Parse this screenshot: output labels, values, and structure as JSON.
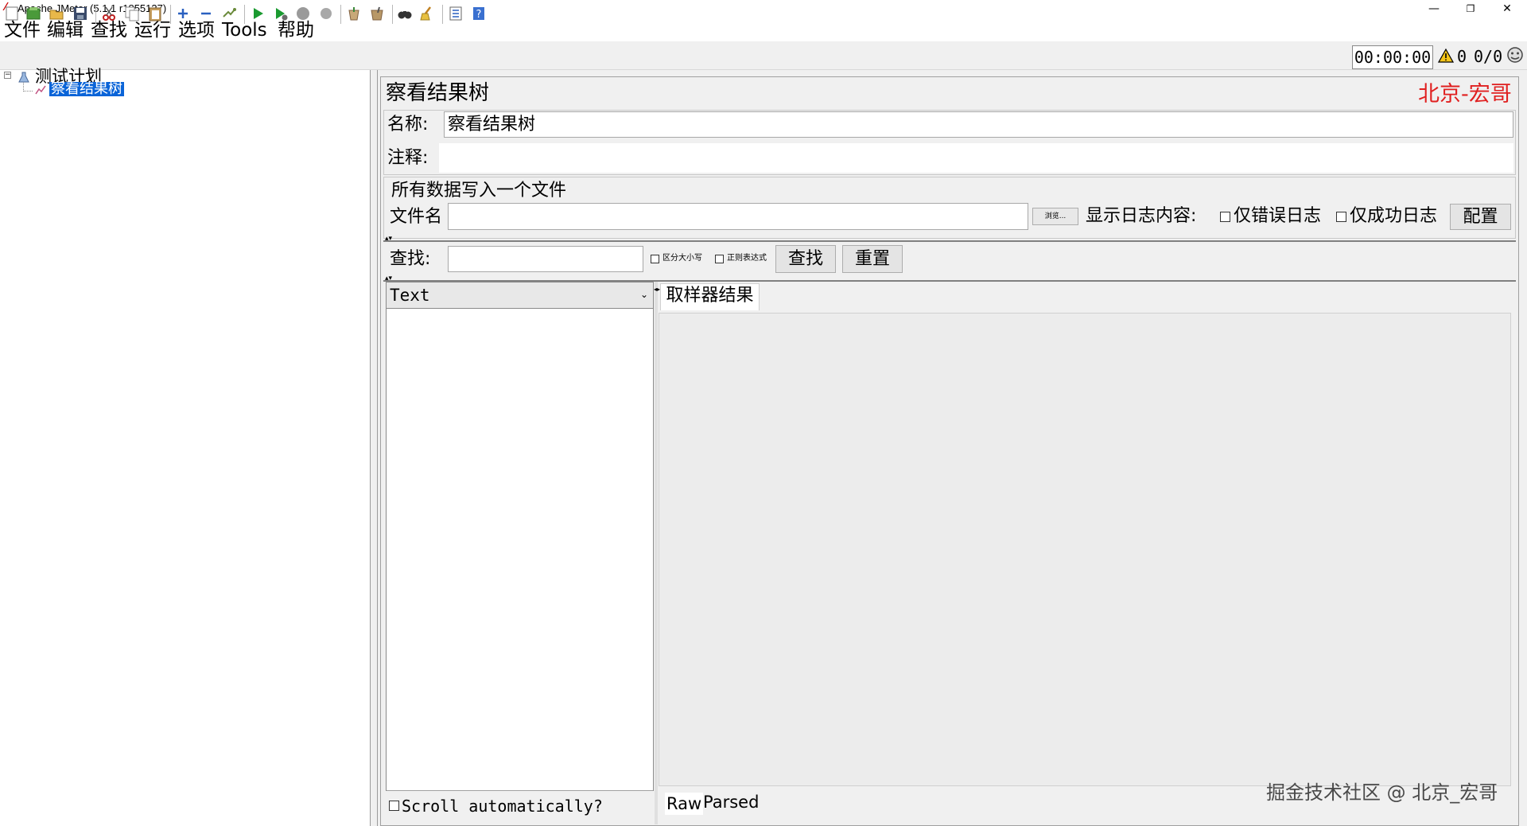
{
  "window": {
    "title": "Apache JMeter (5.1.1 r1855137)",
    "minimize": "—",
    "restore": "❐",
    "close": "✕"
  },
  "menu": [
    "文件",
    "编辑",
    "查找",
    "运行",
    "选项",
    "Tools",
    "帮助"
  ],
  "toolbar": {
    "timer": "00:00:00",
    "warning_count": "0",
    "threads": "0/0"
  },
  "tree": {
    "root": "测试计划",
    "child": "察看结果树"
  },
  "panel": {
    "title": "察看结果树",
    "watermark": "北京-宏哥",
    "name_label": "名称:",
    "name_value": "察看结果树",
    "comment_label": "注释:",
    "comment_value": "",
    "file_section_title": "所有数据写入一个文件",
    "filename_label": "文件名",
    "filename_value": "",
    "browse_label": "浏览...",
    "log_label": "显示日志内容:",
    "errors_only": "仅错误日志",
    "success_only": "仅成功日志",
    "config_button": "配置"
  },
  "search": {
    "label": "查找:",
    "value": "",
    "case_sensitive": "区分大小写",
    "regex": "正则表达式",
    "find_button": "查找",
    "reset_button": "重置"
  },
  "results": {
    "renderer": "Text",
    "scroll_label": "Scroll automatically?",
    "tab_sampler": "取样器结果",
    "tab_raw": "Raw",
    "tab_parsed": "Parsed"
  },
  "footer": {
    "watermark": "掘金技术社区 @ 北京_宏哥"
  },
  "colors": {
    "accent_red": "#e02020",
    "selection_blue": "#0a64d8"
  }
}
